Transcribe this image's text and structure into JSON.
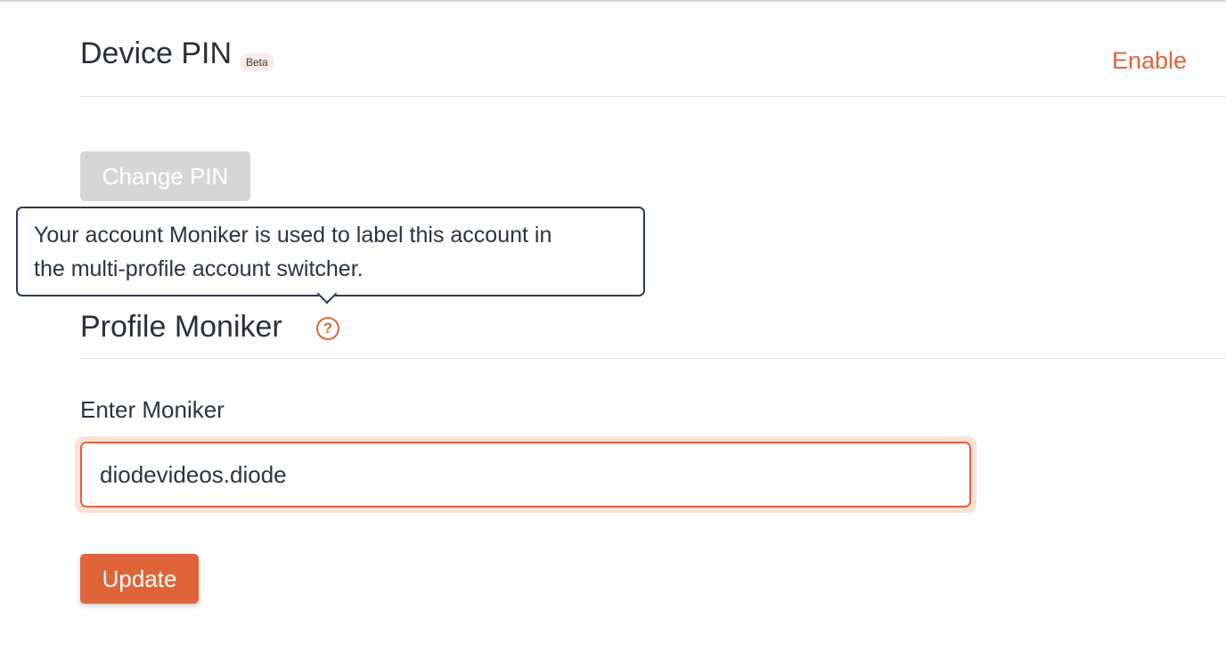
{
  "device_pin": {
    "title": "Device PIN",
    "badge": "Beta",
    "enable_label": "Enable",
    "change_pin_label": "Change PIN"
  },
  "tooltip": {
    "line1": "Your account Moniker is used to label this account in",
    "line2": "the multi-profile account switcher."
  },
  "profile_moniker": {
    "title": "Profile Moniker",
    "help_icon": "question-circle-icon",
    "help_glyph": "?",
    "field_label": "Enter Moniker",
    "field_value": "diodevideos.diode",
    "update_label": "Update"
  },
  "colors": {
    "accent": "#e0643a",
    "disabled_button": "#d6d6d6",
    "badge_bg": "#fbeae5",
    "tooltip_border": "#2e3a4f"
  }
}
